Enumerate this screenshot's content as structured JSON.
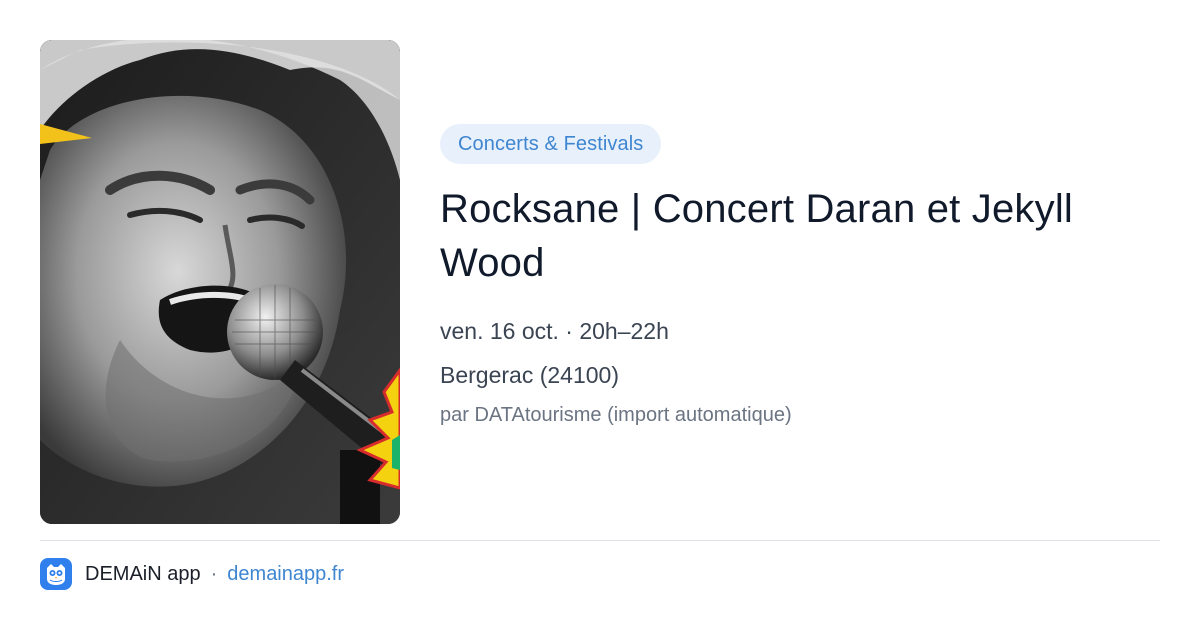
{
  "event": {
    "image_alt": "Concert photo of singer at microphone",
    "category": "Concerts & Festivals",
    "title": "Rocksane | Concert Daran et Jekyll Wood",
    "datetime": "ven. 16 oct. · 20h–22h",
    "location": "Bergerac (24100)",
    "source": "par DATAtourisme (import automatique)"
  },
  "footer": {
    "app_logo_icon": "owl-icon",
    "app_name": "DEMAiN app",
    "separator": "·",
    "app_url": "demainapp.fr"
  },
  "colors": {
    "accent": "#3f86d1",
    "badge_bg": "#e8f1fb",
    "title": "#101a2b",
    "logo_bg": "#2f80ed"
  }
}
